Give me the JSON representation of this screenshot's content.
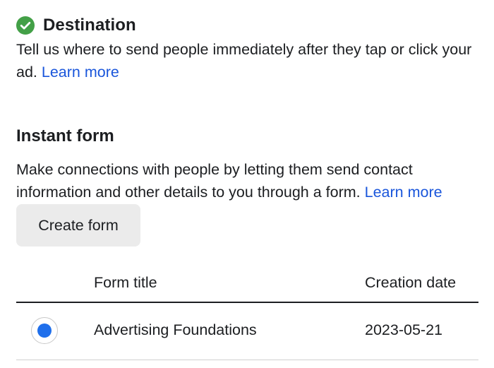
{
  "destination": {
    "title": "Destination",
    "status_icon": "check-circle-icon",
    "status_color": "#43a047",
    "description": "Tell us where to send people immediately after they tap or click your ad.",
    "learn_more": "Learn more"
  },
  "instant_form": {
    "title": "Instant form",
    "description": "Make connections with people by letting them send contact information and other details to you through a form.",
    "learn_more": "Learn more",
    "create_button": "Create form"
  },
  "forms_table": {
    "columns": [
      "Form title",
      "Creation date"
    ],
    "rows": [
      {
        "selected": true,
        "title": "Advertising Foundations",
        "creation_date": "2023-05-21"
      }
    ]
  },
  "colors": {
    "link": "#1a56db",
    "radio_selected": "#1f6feb",
    "button_bg": "#ebebeb"
  }
}
